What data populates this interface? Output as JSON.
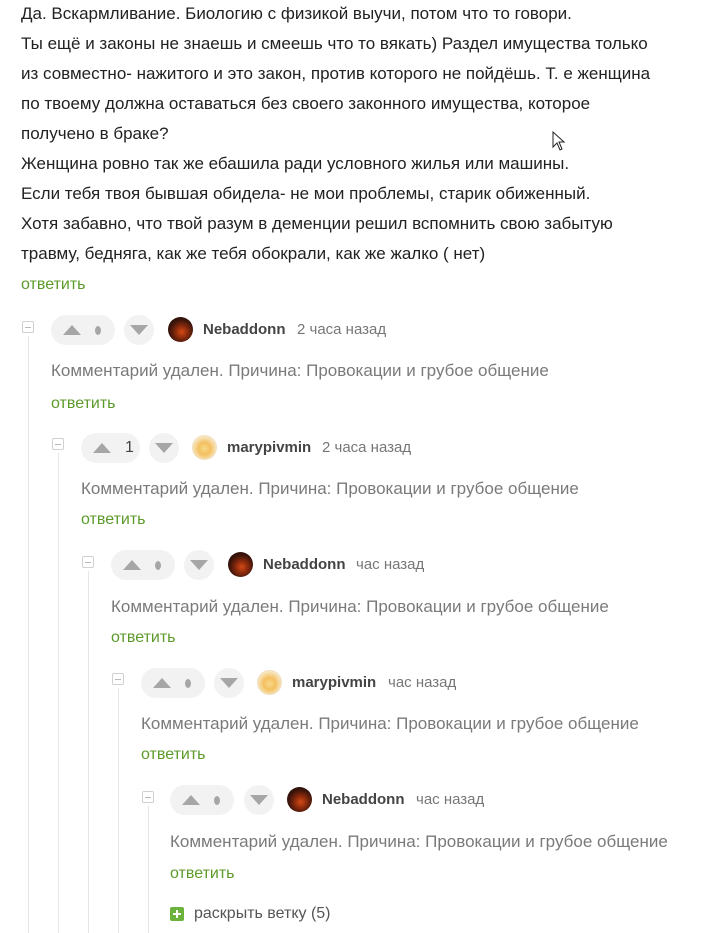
{
  "top_comment": {
    "lines": [
      "Да. Вскармливание. Биологию с физикой выучи, потом что то говори.",
      "Ты ещё и законы не знаешь и смеешь что то вякать) Раздел имущества только",
      "из совместно- нажитого и это закон, против которого не пойдёшь. Т. е женщина",
      "по твоему должна оставаться без своего законного имущества, которое",
      "получено в браке?",
      "Женщина ровно так же ебашила ради условного жилья или машины.",
      "Если тебя твоя бывшая обидела- не мои проблемы, старик обиженный.",
      "Хотя забавно, что твой разум в деменции решил вспомнить свою забытую",
      "травму, бедняга, как же тебя обокрали, как же жалко ( нет)"
    ],
    "reply_label": "ответить"
  },
  "comments": [
    {
      "username": "Nebaddonn",
      "time": "2 часа назад",
      "score": "",
      "body": "Комментарий удален. Причина: Провокации и грубое общение",
      "reply_label": "ответить",
      "avatar": "dark"
    },
    {
      "username": "marypivmin",
      "time": "2 часа назад",
      "score": "1",
      "body": "Комментарий удален. Причина: Провокации и грубое общение",
      "reply_label": "ответить",
      "avatar": "light"
    },
    {
      "username": "Nebaddonn",
      "time": "час назад",
      "score": "",
      "body": "Комментарий удален. Причина: Провокации и грубое общение",
      "reply_label": "ответить",
      "avatar": "dark"
    },
    {
      "username": "marypivmin",
      "time": "час назад",
      "score": "",
      "body": "Комментарий удален. Причина: Провокации и грубое общение",
      "reply_label": "ответить",
      "avatar": "light"
    },
    {
      "username": "Nebaddonn",
      "time": "час назад",
      "score": "",
      "body": "Комментарий удален. Причина: Провокации и грубое общение",
      "reply_label": "ответить",
      "avatar": "dark"
    }
  ],
  "expand_branch": {
    "label": "раскрыть ветку (5)"
  },
  "colors": {
    "accent_green": "#5c9a2a",
    "expand_green": "#6cb33e",
    "deleted_text": "#7a7a7a"
  }
}
